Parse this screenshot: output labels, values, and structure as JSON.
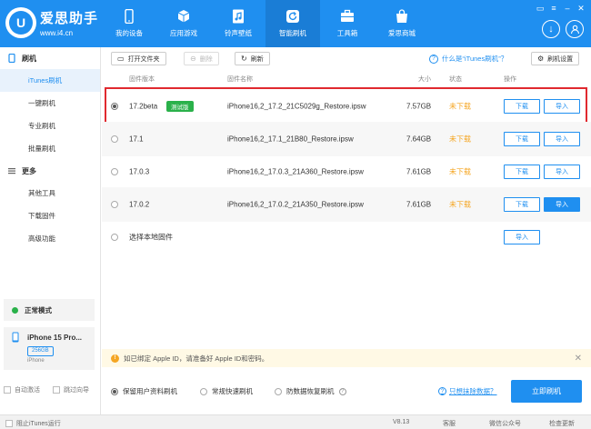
{
  "app": {
    "brand": "爱思助手",
    "url": "www.i4.cn",
    "logo_char": "U"
  },
  "nav": [
    {
      "label": "我的设备",
      "icon": "phone-icon"
    },
    {
      "label": "应用游戏",
      "icon": "cube-icon"
    },
    {
      "label": "铃声壁纸",
      "icon": "music-file-icon"
    },
    {
      "label": "智能刷机",
      "icon": "refresh-icon"
    },
    {
      "label": "工具箱",
      "icon": "toolbox-icon"
    },
    {
      "label": "爱思商城",
      "icon": "bag-icon"
    }
  ],
  "sidebar": {
    "section1": "刷机",
    "items1": [
      "iTunes刷机",
      "一键刷机",
      "专业刷机",
      "批量刷机"
    ],
    "section2": "更多",
    "items2": [
      "其他工具",
      "下载固件",
      "高级功能"
    ],
    "mode": "正常模式",
    "device": {
      "name": "iPhone 15 Pro...",
      "capacity": "256GB",
      "type": "iPhone"
    },
    "checks": [
      "自动激活",
      "跳过向导"
    ]
  },
  "toolbar": {
    "open_folder": "打开文件夹",
    "delete": "删除",
    "refresh": "刷新",
    "help": "什么是“iTunes刷机”？",
    "settings": "刷机设置"
  },
  "table": {
    "headers": {
      "version": "固件版本",
      "name": "固件名称",
      "size": "大小",
      "status": "状态",
      "action": "操作"
    },
    "rows": [
      {
        "version": "17.2beta",
        "badge": "测试版",
        "name": "iPhone16,2_17.2_21C5029g_Restore.ipsw",
        "size": "7.57GB",
        "status": "未下载",
        "download": "下载",
        "import": "导入"
      },
      {
        "version": "17.1",
        "badge": "",
        "name": "iPhone16,2_17.1_21B80_Restore.ipsw",
        "size": "7.64GB",
        "status": "未下载",
        "download": "下载",
        "import": "导入"
      },
      {
        "version": "17.0.3",
        "badge": "",
        "name": "iPhone16,2_17.0.3_21A360_Restore.ipsw",
        "size": "7.61GB",
        "status": "未下载",
        "download": "下载",
        "import": "导入"
      },
      {
        "version": "17.0.2",
        "badge": "",
        "name": "iPhone16,2_17.0.2_21A350_Restore.ipsw",
        "size": "7.61GB",
        "status": "未下载",
        "download": "下载",
        "import": "导入"
      }
    ],
    "local": {
      "label": "选择本地固件",
      "import": "导入"
    }
  },
  "notice": "如已绑定 Apple ID，请准备好 Apple ID和密码。",
  "options": {
    "keep_data": "保留用户资料刷机",
    "quick": "常规快速刷机",
    "recovery": "防数据恢复刷机",
    "erase_link": "只想抹除数据？",
    "flash_button": "立即刷机"
  },
  "statusbar": {
    "block_itunes": "阻止iTunes运行",
    "version": "V8.13",
    "service": "客服",
    "wechat": "微信公众号",
    "update": "检查更新"
  },
  "colors": {
    "primary": "#1f8ff0",
    "pending": "#f5a623",
    "beta": "#2ab14a",
    "highlight": "#e0292f"
  }
}
